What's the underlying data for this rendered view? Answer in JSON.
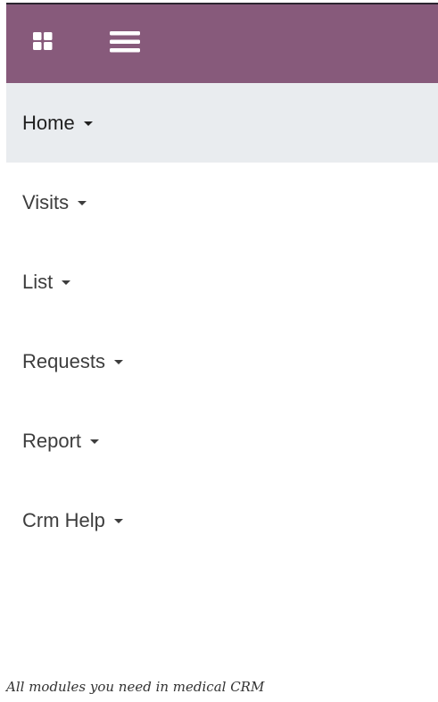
{
  "header": {
    "background": "#875a7b",
    "apps_icon": "grid-apps-icon",
    "menu_icon": "hamburger-menu-icon"
  },
  "nav": {
    "active_background": "#e9ecef",
    "items": [
      {
        "label": "Home",
        "active": true
      },
      {
        "label": "Visits",
        "active": false
      },
      {
        "label": "List",
        "active": false
      },
      {
        "label": "Requests",
        "active": false
      },
      {
        "label": "Report",
        "active": false
      },
      {
        "label": "Crm Help",
        "active": false
      }
    ]
  },
  "footer": {
    "tagline": "All modules you need in medical CRM"
  }
}
